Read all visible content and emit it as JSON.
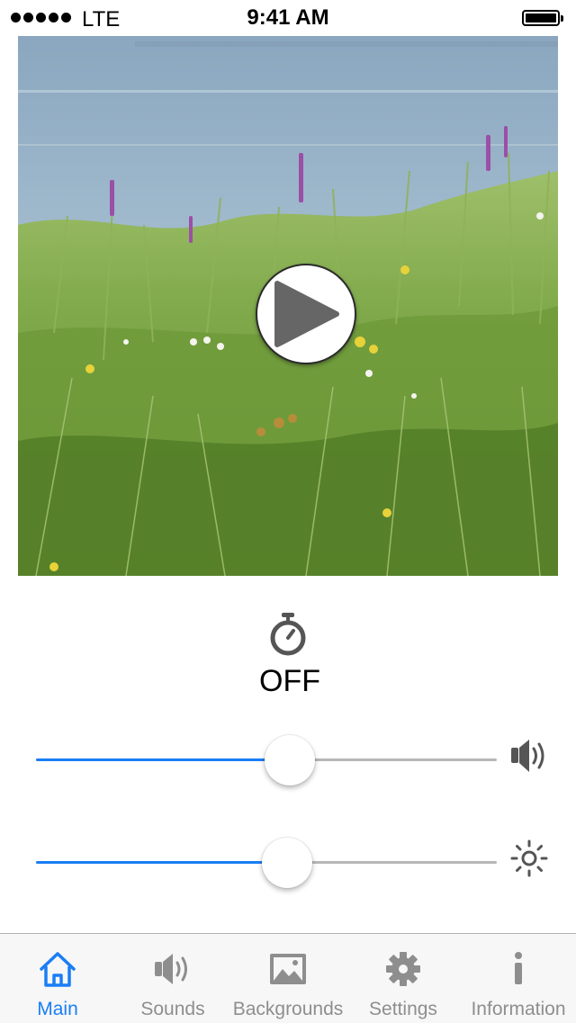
{
  "status_bar": {
    "carrier": "LTE",
    "time": "9:41 AM",
    "signal_bars": 5,
    "battery_level": 1.0
  },
  "scene": {
    "icon": "play-icon"
  },
  "timer": {
    "icon": "stopwatch-icon",
    "label": "OFF"
  },
  "sliders": {
    "volume": {
      "value": 0.55,
      "icon": "speaker-icon"
    },
    "brightness": {
      "value": 0.545,
      "icon": "sun-icon"
    }
  },
  "tab_bar": {
    "tabs": [
      {
        "label": "Main",
        "icon": "home-icon",
        "active": true
      },
      {
        "label": "Sounds",
        "icon": "speaker-icon",
        "active": false
      },
      {
        "label": "Backgrounds",
        "icon": "picture-icon",
        "active": false
      },
      {
        "label": "Settings",
        "icon": "gear-icon",
        "active": false
      },
      {
        "label": "Information",
        "icon": "info-icon",
        "active": false
      }
    ]
  },
  "colors": {
    "accent": "#1a7ef5",
    "tab_inactive": "#8e8e8e",
    "tab_bar_bg": "#f7f7f7",
    "track": "#b7b7b7"
  }
}
